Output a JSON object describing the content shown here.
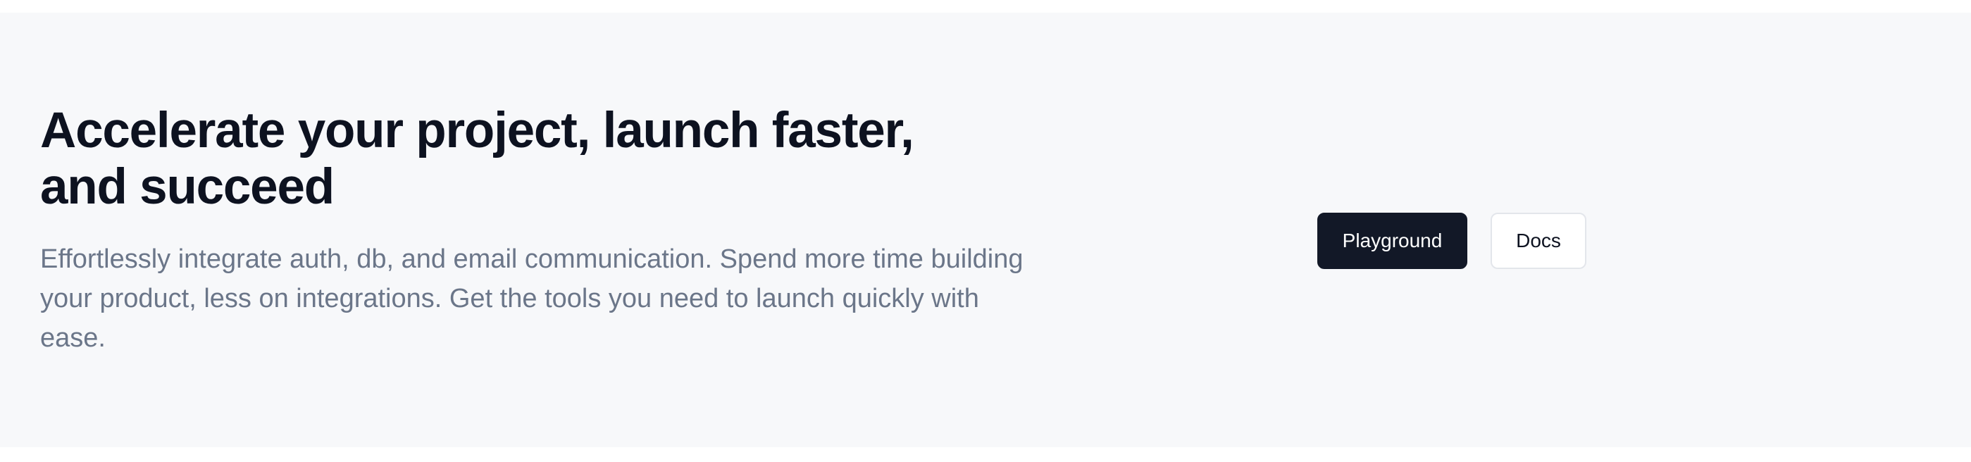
{
  "hero": {
    "title": "Accelerate your project, launch faster, and succeed",
    "subtitle": "Effortlessly integrate auth, db, and email communication. Spend more time building your product, less on integrations. Get the tools you need to launch quickly with ease.",
    "primary_button_label": "Playground",
    "secondary_button_label": "Docs"
  },
  "colors": {
    "background": "#f7f8fa",
    "title": "#0d1220",
    "subtitle": "#6b7689",
    "primary_button": "#121827"
  }
}
